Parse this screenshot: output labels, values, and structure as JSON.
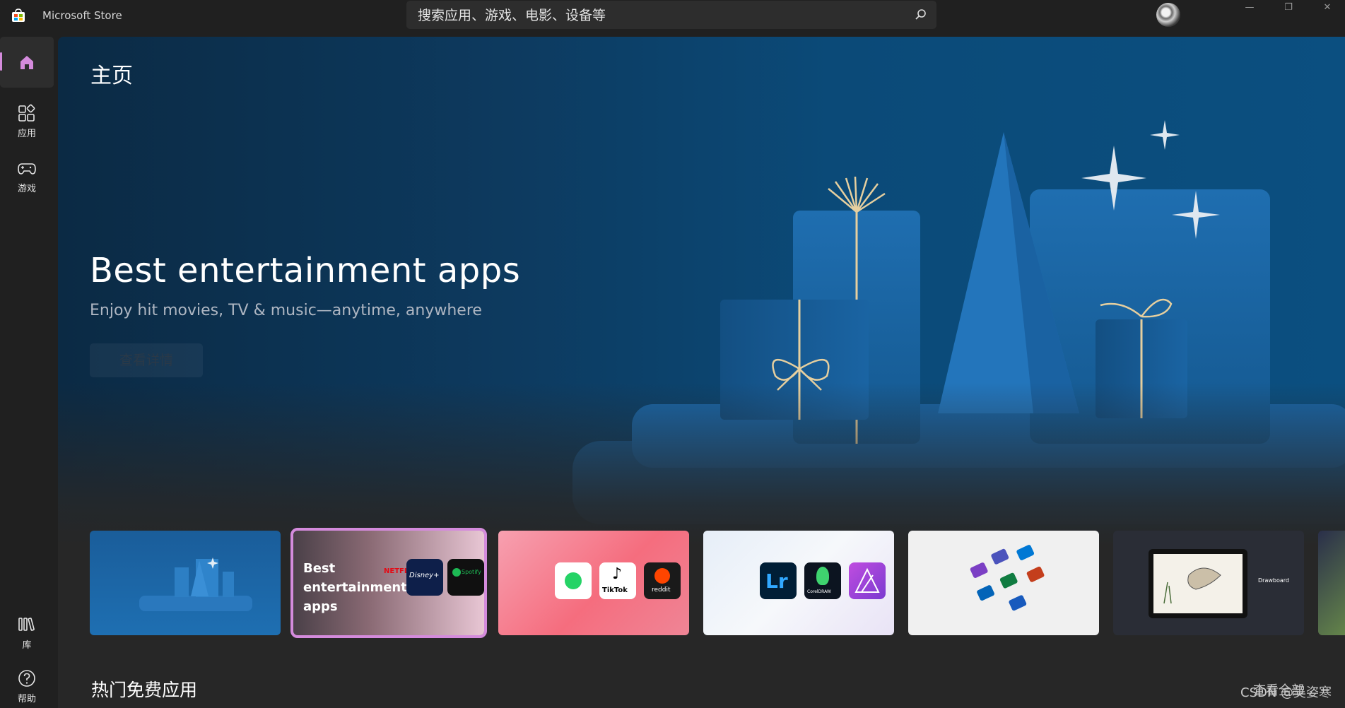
{
  "app": {
    "title": "Microsoft Store"
  },
  "search": {
    "placeholder": "搜索应用、游戏、电影、设备等"
  },
  "window_controls": {
    "minimize": "—",
    "maximize": "❐",
    "close": "✕"
  },
  "sidebar": {
    "items": [
      {
        "id": "home",
        "label": "",
        "icon": "home-icon",
        "active": true
      },
      {
        "id": "apps",
        "label": "应用",
        "icon": "apps-icon"
      },
      {
        "id": "games",
        "label": "游戏",
        "icon": "gamepad-icon"
      },
      {
        "id": "library",
        "label": "库",
        "icon": "library-icon"
      },
      {
        "id": "help",
        "label": "帮助",
        "icon": "help-icon"
      }
    ]
  },
  "main": {
    "page_title": "主页",
    "hero": {
      "title": "Best entertainment apps",
      "subtitle": "Enjoy hit movies, TV & music—anytime, anywhere",
      "button_label": "查看详情"
    },
    "cards": [
      {
        "name": "gifts-hero-thumbnail"
      },
      {
        "name": "best-entertainment-apps",
        "label": "Best entertainment apps",
        "selected": true,
        "tiles": [
          "NETFLIX",
          "Disney+",
          "Spotify"
        ]
      },
      {
        "name": "social-apps",
        "tiles": [
          "WhatsApp",
          "TikTok",
          "reddit"
        ]
      },
      {
        "name": "creative-apps",
        "tiles": [
          "Lr",
          "CorelDRAW",
          "Affinity"
        ]
      },
      {
        "name": "office-apps"
      },
      {
        "name": "drawboard-app",
        "label": "Drawboard"
      },
      {
        "name": "game-art-partial"
      }
    ],
    "section": {
      "title": "热门免费应用",
      "see_all": "查看全部"
    }
  },
  "watermark": "CSDN @吴姿寒",
  "colors": {
    "accent": "#d48bdc",
    "background": "#202020",
    "hero_blue": "#0b4f80"
  }
}
